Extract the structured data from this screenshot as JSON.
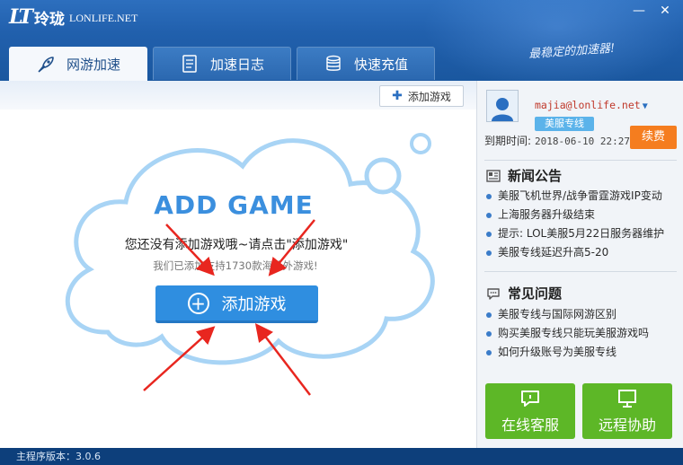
{
  "app": {
    "logo_mark": "LT",
    "logo_cn": "玲珑",
    "logo_en": "LONLIFE.NET",
    "slogan": "最稳定的加速器!",
    "minimize": "—",
    "close": "✕"
  },
  "tabs": [
    {
      "label": "网游加速",
      "icon": "rocket-icon",
      "active": true
    },
    {
      "label": "加速日志",
      "icon": "document-icon",
      "active": false
    },
    {
      "label": "快速充值",
      "icon": "coins-icon",
      "active": false
    }
  ],
  "main": {
    "add_game_small": "添加游戏",
    "headline": "ADD GAME",
    "message": "您还没有添加游戏哦~请点击\"添加游戏\"",
    "sub_message": "我们已添加支持1730款海外外游戏!",
    "add_game_button": "添加游戏"
  },
  "user": {
    "email": "majia@lonlife.net",
    "plan_badge": "美服专线",
    "expire_label": "到期时间:",
    "expire_value": "2018-06-10 22:27",
    "renew_label": "续费"
  },
  "news": {
    "title": "新闻公告",
    "items": [
      "美服飞机世界/战争雷霆游戏IP变动",
      "上海服务器升级结束",
      "提示: LOL美服5月22日服务器维护",
      "美服专线延迟升高5-20"
    ]
  },
  "faq": {
    "title": "常见问题",
    "items": [
      "美服专线与国际网游区别",
      "购买美服专线只能玩美服游戏吗",
      "如何升级账号为美服专线"
    ]
  },
  "actions": {
    "online_service": "在线客服",
    "remote_assist": "远程协助"
  },
  "status": {
    "version_text": "主程序版本：3.0.6"
  },
  "colors": {
    "brand_blue": "#2f8ee0",
    "renew_orange": "#f57d1f",
    "action_green": "#5db727",
    "email_red": "#c0392b",
    "arrow_red": "#e8261f"
  }
}
